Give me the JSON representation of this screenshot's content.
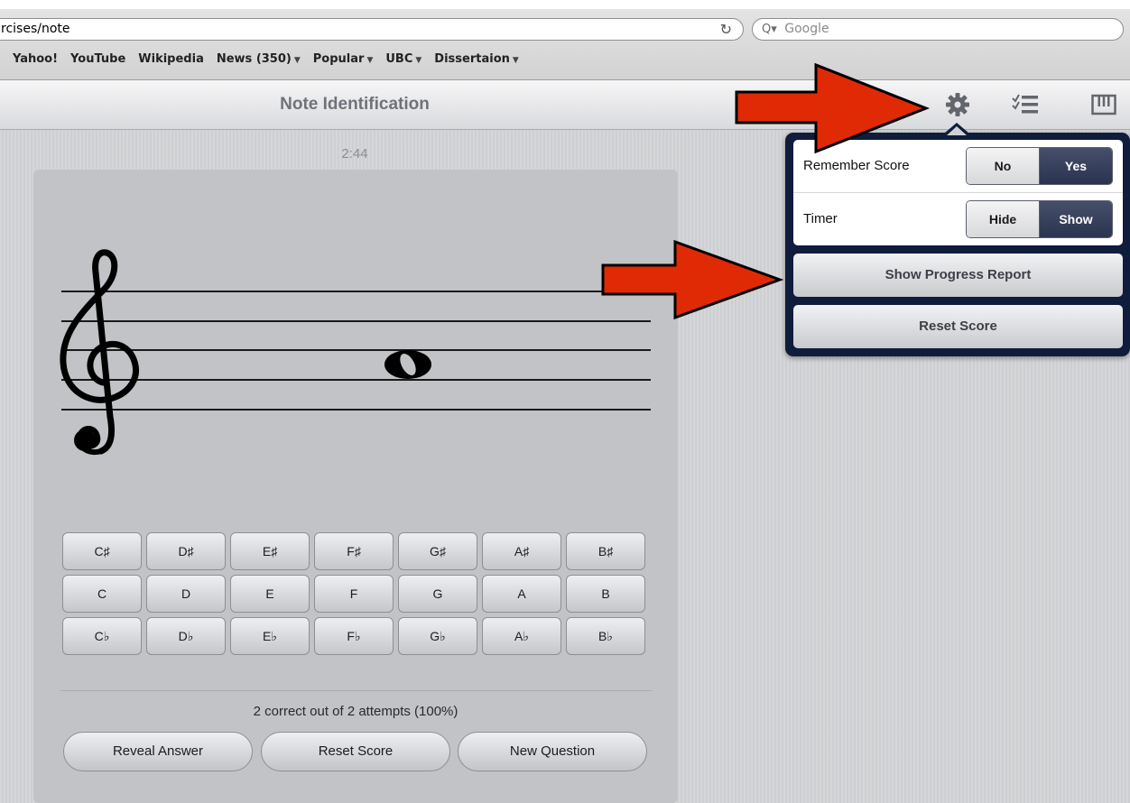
{
  "browser": {
    "url": "rcises/note",
    "search_placeholder": "Google",
    "bookmarks": [
      "Yahoo!",
      "YouTube",
      "Wikipedia",
      "News (350)",
      "Popular",
      "UBC",
      "Dissertaion"
    ]
  },
  "app": {
    "title": "Note Identification",
    "icons": [
      "settings-gear-icon",
      "checklist-icon",
      "keyboard-icon"
    ]
  },
  "exercise": {
    "timer": "2:44",
    "clef": "treble",
    "note_buttons": {
      "sharps": [
        "C♯",
        "D♯",
        "E♯",
        "F♯",
        "G♯",
        "A♯",
        "B♯"
      ],
      "naturals": [
        "C",
        "D",
        "E",
        "F",
        "G",
        "A",
        "B"
      ],
      "flats": [
        "C♭",
        "D♭",
        "E♭",
        "F♭",
        "G♭",
        "A♭",
        "B♭"
      ]
    },
    "score_text": "2 correct out of 2 attempts (100%)",
    "actions": {
      "reveal": "Reveal Answer",
      "reset": "Reset Score",
      "new": "New Question"
    }
  },
  "settings_popover": {
    "remember_score": {
      "label": "Remember Score",
      "options": [
        "No",
        "Yes"
      ],
      "selected": "Yes"
    },
    "timer": {
      "label": "Timer",
      "options": [
        "Hide",
        "Show"
      ],
      "selected": "Show"
    },
    "progress_button": "Show Progress Report",
    "reset_button": "Reset Score"
  },
  "colors": {
    "annotation_arrow": "#e02a06",
    "popover_border": "#0f1c3c",
    "segment_selected": "#2f3854"
  }
}
